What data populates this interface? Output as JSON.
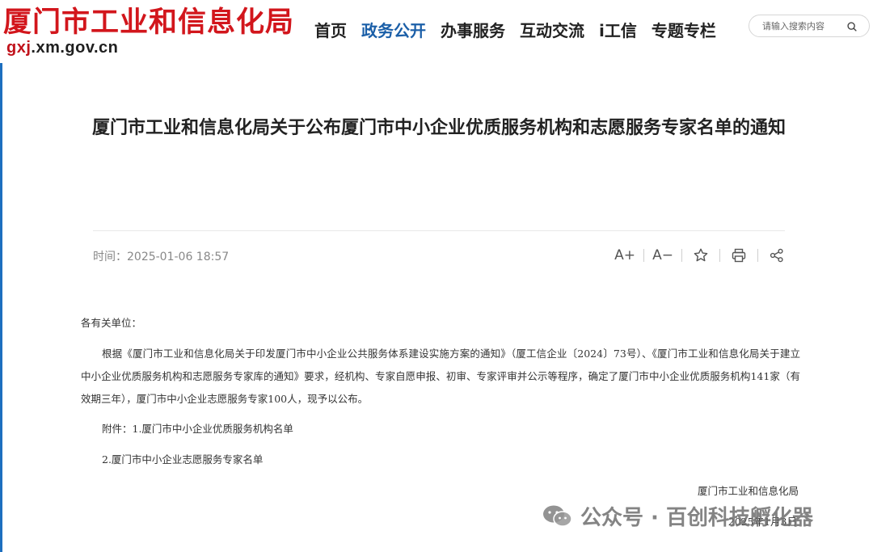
{
  "header": {
    "site_name": "厦门市工业和信息化局",
    "domain_main": "gxj",
    "domain_rest": ".xm.gov.cn"
  },
  "nav": {
    "items": [
      {
        "label": "首页"
      },
      {
        "label": "政务公开"
      },
      {
        "label": "办事服务"
      },
      {
        "label": "互动交流"
      },
      {
        "label": "i工信"
      },
      {
        "label": "专题专栏"
      }
    ]
  },
  "search": {
    "placeholder": "请输入搜索内容"
  },
  "article": {
    "title": "厦门市工业和信息化局关于公布厦门市中小企业优质服务机构和志愿服务专家名单的通知",
    "time_label": "时间：",
    "time_value": "2025-01-06 18:57",
    "tools": {
      "font_up": "A+",
      "font_down": "A−"
    },
    "salutation": "各有关单位：",
    "paragraph": "根据《厦门市工业和信息化局关于印发厦门市中小企业公共服务体系建设实施方案的通知》（厦工信企业〔2024〕73号）、《厦门市工业和信息化局关于建立中小企业优质服务机构和志愿服务专家库的通知》要求，经机构、专家自愿申报、初审、专家评审并公示等程序，确定了厦门市中小企业优质服务机构141家（有效期三年），厦门市中小企业志愿服务专家100人，现予以公布。",
    "attachment_1": "附件：1.厦门市中小企业优质服务机构名单",
    "attachment_2": "2.厦门市中小企业志愿服务专家名单",
    "sign_org": "厦门市工业和信息化局",
    "sign_date": "2025年1月3日"
  },
  "watermark": {
    "text": "公众号 · 百创科技孵化器"
  },
  "colors": {
    "brand_red": "#d2161c",
    "nav_active": "#1b5fa8",
    "left_bar": "#1d6fbf"
  }
}
